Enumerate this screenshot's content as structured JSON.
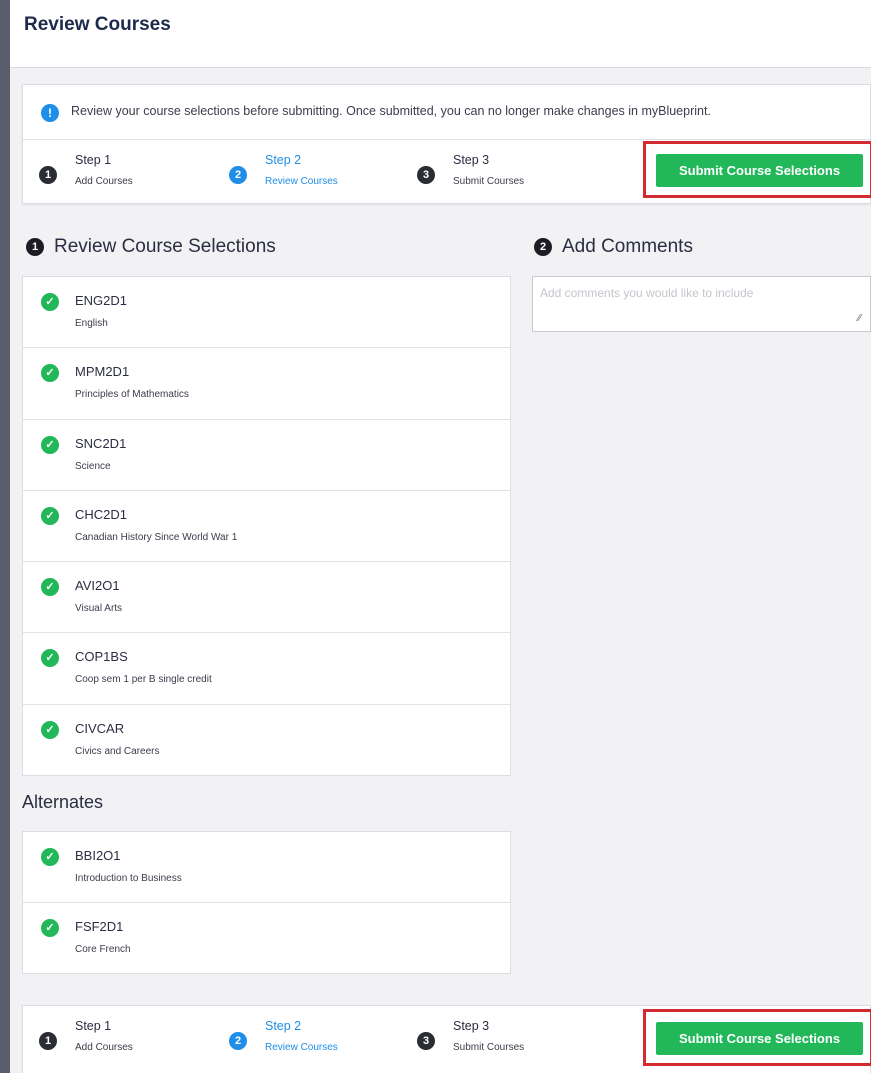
{
  "header": {
    "title": "Review Courses"
  },
  "info": {
    "icon": "info-icon",
    "text": "Review your course selections before submitting. Once submitted, you can no longer make changes in myBlueprint."
  },
  "steps": [
    {
      "number": "1",
      "title": "Step 1",
      "subtitle": "Add Courses",
      "active": false
    },
    {
      "number": "2",
      "title": "Step 2",
      "subtitle": "Review Courses",
      "active": true
    },
    {
      "number": "3",
      "title": "Step 3",
      "subtitle": "Submit Courses",
      "active": false
    }
  ],
  "submit_label": "Submit Course Selections",
  "review": {
    "number": "1",
    "heading": "Review Course Selections",
    "courses": [
      {
        "code": "ENG2D1",
        "name": "English"
      },
      {
        "code": "MPM2D1",
        "name": "Principles of Mathematics"
      },
      {
        "code": "SNC2D1",
        "name": "Science"
      },
      {
        "code": "CHC2D1",
        "name": "Canadian History Since World War 1"
      },
      {
        "code": "AVI2O1",
        "name": "Visual Arts"
      },
      {
        "code": "COP1BS",
        "name": "Coop sem 1 per B single credit"
      },
      {
        "code": "CIVCAR",
        "name": "Civics and Careers"
      }
    ]
  },
  "alternates": {
    "heading": "Alternates",
    "courses": [
      {
        "code": "BBI2O1",
        "name": "Introduction to Business"
      },
      {
        "code": "FSF2D1",
        "name": "Core French"
      }
    ]
  },
  "comments": {
    "number": "2",
    "heading": "Add Comments",
    "placeholder": "Add comments you would like to include",
    "value": ""
  },
  "colors": {
    "accent_blue": "#1f8ee8",
    "submit_green": "#22b85a",
    "highlight_red": "#d42b30",
    "check_green": "#22b85a"
  }
}
